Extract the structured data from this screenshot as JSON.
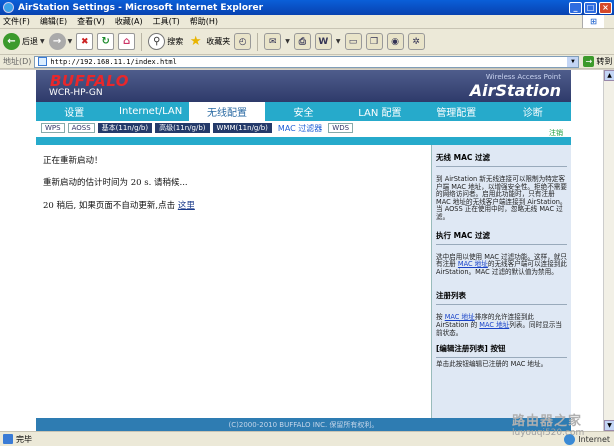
{
  "window": {
    "title": "AirStation Settings - Microsoft Internet Explorer"
  },
  "menu": [
    "文件(F)",
    "编辑(E)",
    "查看(V)",
    "收藏(A)",
    "工具(T)",
    "帮助(H)"
  ],
  "toolbar": {
    "back_label": "后退",
    "search_label": "搜索",
    "favorites_label": "收藏夹"
  },
  "address": {
    "label": "地址(D)",
    "url": "http://192.168.11.1/index.html",
    "go_label": "转到"
  },
  "router": {
    "brand": "BUFFALO",
    "model": "WCR-HP-GN",
    "product_line": "Wireless Access Point",
    "product_name": "AirStation",
    "nav": [
      "设置",
      "Internet/LAN",
      "无线配置",
      "安全",
      "LAN 配置",
      "管理配置",
      "诊断"
    ],
    "active_nav": "无线配置",
    "subnav": [
      {
        "label": "WPS",
        "style": "plain"
      },
      {
        "label": "AOSS",
        "style": "plain"
      },
      {
        "label": "基本(11n/g/b)",
        "style": "dark"
      },
      {
        "label": "高级(11n/g/b)",
        "style": "dark"
      },
      {
        "label": "WMM(11n/g/b)",
        "style": "dark"
      },
      {
        "label": "MAC 过滤器",
        "style": "current"
      },
      {
        "label": "WDS",
        "style": "plain"
      }
    ],
    "logout": "注销",
    "content": {
      "line1": "正在重新启动！",
      "line2": "重新启动的估计时间为  20 s. 请稍候...",
      "line3_prefix": "20 稍后, 如果页面不自动更新,点击 ",
      "line3_link": "这里"
    },
    "help": {
      "title1": "无线  MAC 过滤",
      "text1": "到  AirStation 新无线连接可以限制为特定客户端 MAC 地址，以增强安全性。拒绝不需要的网络访问者。启用此功能时，只有注册 MAC 地址的无线客户端连接到 AirStation。当 AOSS 正在使用中时，忽略无线 MAC 过滤。",
      "title2": "执行  MAC 过滤",
      "text2a": "选中启用以使用  MAC 过滤功能。这样，就只有注册 ",
      "text2_link": "MAC 地址",
      "text2b": "的无线客户端可以连接到此 AirStation。MAC 过滤的默认值为禁用。",
      "title3": "注册列表",
      "text3a": "按 ",
      "text3_link1": "MAC 地址",
      "text3b": "排序的允许连接到此 AirStation 的 ",
      "text3_link2": "MAC 地址",
      "text3c": "列表。同时显示当前状态。",
      "title4": "[编辑注册列表] 按钮",
      "text4": "单击此按钮编辑已注册的  MAC 地址。"
    },
    "footer": "(C)2000-2010 BUFFALO INC. 保留所有权利。"
  },
  "status": {
    "text": "完毕",
    "zone": "Internet"
  },
  "watermark": {
    "line1": "路由器之家",
    "line2": "luyouqi520.com"
  }
}
